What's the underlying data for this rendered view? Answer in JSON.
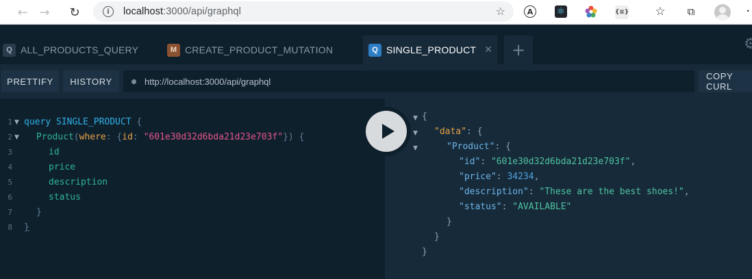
{
  "browser": {
    "url_host": "localhost",
    "url_path": ":3000/api/graphql",
    "icons": [
      "back-arrow-icon",
      "forward-arrow-icon",
      "reload-icon",
      "info-icon",
      "add-bookmark-icon",
      "translate-extension-icon",
      "react-devtools-icon",
      "flower-extension-icon",
      "json-extension-icon",
      "favorites-icon",
      "collections-icon",
      "profile-avatar",
      "more-icon"
    ],
    "json_ext_label": "{≡}"
  },
  "tabs": [
    {
      "badge": "Q",
      "label": "ALL_PRODUCTS_QUERY",
      "active": false
    },
    {
      "badge": "M",
      "label": "CREATE_PRODUCT_MUTATION",
      "active": false
    },
    {
      "badge": "Q",
      "label": "SINGLE_PRODUCT",
      "active": true
    }
  ],
  "toolbar": {
    "prettify_label": "PRETTIFY",
    "history_label": "HISTORY",
    "endpoint": "http://localhost:3000/api/graphql",
    "copy_curl_label": "COPY CURL"
  },
  "query_editor": {
    "line_numbers": [
      "1",
      "2",
      "3",
      "4",
      "5",
      "6",
      "7",
      "8"
    ],
    "operation_keyword": "query",
    "operation_name": "SINGLE_PRODUCT",
    "open_brace": "{",
    "field_product": "Product",
    "paren_open": "(",
    "arg_where": "where",
    "colon": ":",
    "arg_open_brace": "{",
    "arg_id": "id",
    "arg_id_value": "\"601e30d32d6bda21d23e703f\"",
    "arg_close": "})",
    "field_id": "id",
    "field_price": "price",
    "field_description": "description",
    "field_status": "status",
    "inner_close": "}",
    "outer_close": "}"
  },
  "result": {
    "open": "{",
    "data_key": "\"data\"",
    "product_key": "\"Product\"",
    "id_key": "\"id\"",
    "id_value": "\"601e30d32d6bda21d23e703f\"",
    "price_key": "\"price\"",
    "price_value": "34234",
    "description_key": "\"description\"",
    "description_value": "\"These are the best shoes!\"",
    "status_key": "\"status\"",
    "status_value": "\"AVAILABLE\"",
    "close_product": "}",
    "close_data": "}",
    "close_root": "}"
  }
}
